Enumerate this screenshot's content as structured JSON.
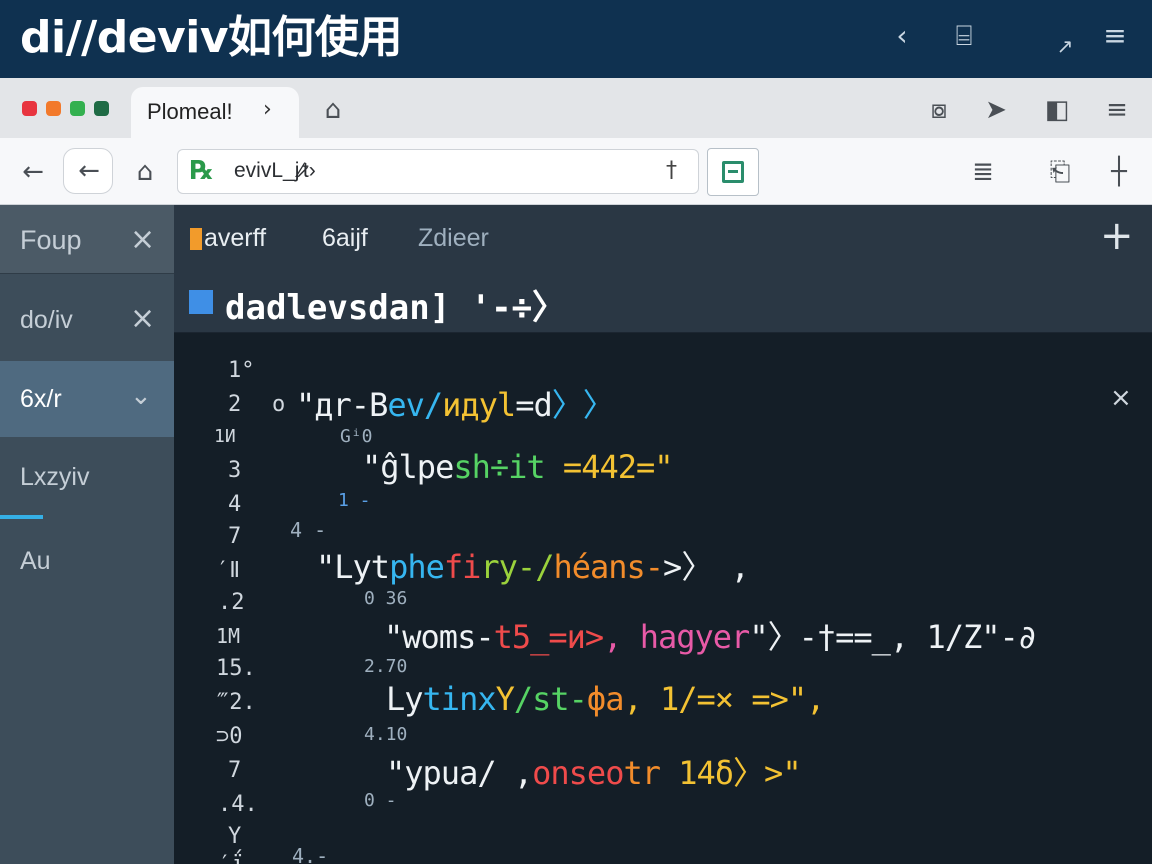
{
  "banner": {
    "title": "di/∕deviv如何使用",
    "icons": [
      "back-chevron-icon",
      "split-window-icon",
      "expand-icon",
      "menu-icon"
    ]
  },
  "tab_bar": {
    "traffic_lights": [
      "#e8343f",
      "#f2792b",
      "#33b04f",
      "#1f6b45"
    ],
    "tab": {
      "label": "Plomeal!",
      "close": "›"
    },
    "right_icons": [
      "screenshot-icon",
      "send-icon",
      "sidebar-icon",
      "hamburger-icon"
    ]
  },
  "toolbar": {
    "url": "evivL_j∕̷t›",
    "pin_glyph": "†"
  },
  "sidebar": {
    "items": [
      {
        "label": "Foup",
        "action": "×"
      },
      {
        "label": "do/iv",
        "action": "×"
      },
      {
        "label": "6x/r",
        "action": "⌄"
      },
      {
        "label": "Lxzyiv",
        "action": ""
      },
      {
        "label": "Au",
        "action": ""
      }
    ]
  },
  "editor": {
    "tabs": [
      "averff",
      "6aijf",
      "Zdieer"
    ],
    "breadcrumb": "dadlevsdan] '-÷〉",
    "gutter": [
      "1°",
      "2",
      "1И",
      "3",
      "4",
      "7",
      "′Ⅱ",
      ".2",
      "1М",
      "15.",
      "‴2.",
      "⊃0",
      "7",
      ".4.",
      "Y",
      "′ΐ"
    ],
    "hints": [
      "o",
      "Gⁱ0",
      "1 -",
      "4 -",
      "0 36",
      "2.70",
      "4.10",
      "0 -",
      "4.-"
    ],
    "lines": {
      "l1": [
        "\"дr-B",
        "ev/",
        "идyl",
        "=d",
        "〉〉"
      ],
      "l2": [
        "\"ĝlpe",
        "sh÷it",
        " =442=\""
      ],
      "l3": [
        "\"Lyt",
        "phe",
        "fi",
        "ry-/",
        "héans-",
        ">〉 ,"
      ],
      "l4": [
        "\"woms-",
        "t5_=и>",
        ", hagyer",
        "\"〉-†==_, 1∕Z\"-∂"
      ],
      "l5": [
        "Ly",
        "tinx",
        "Y",
        "∕st-",
        "фa",
        ", 1∕=× =>\","
      ],
      "l6": [
        "\"ypua∕ ,",
        "onseo",
        "tr",
        " 14δ〉>\""
      ]
    }
  }
}
